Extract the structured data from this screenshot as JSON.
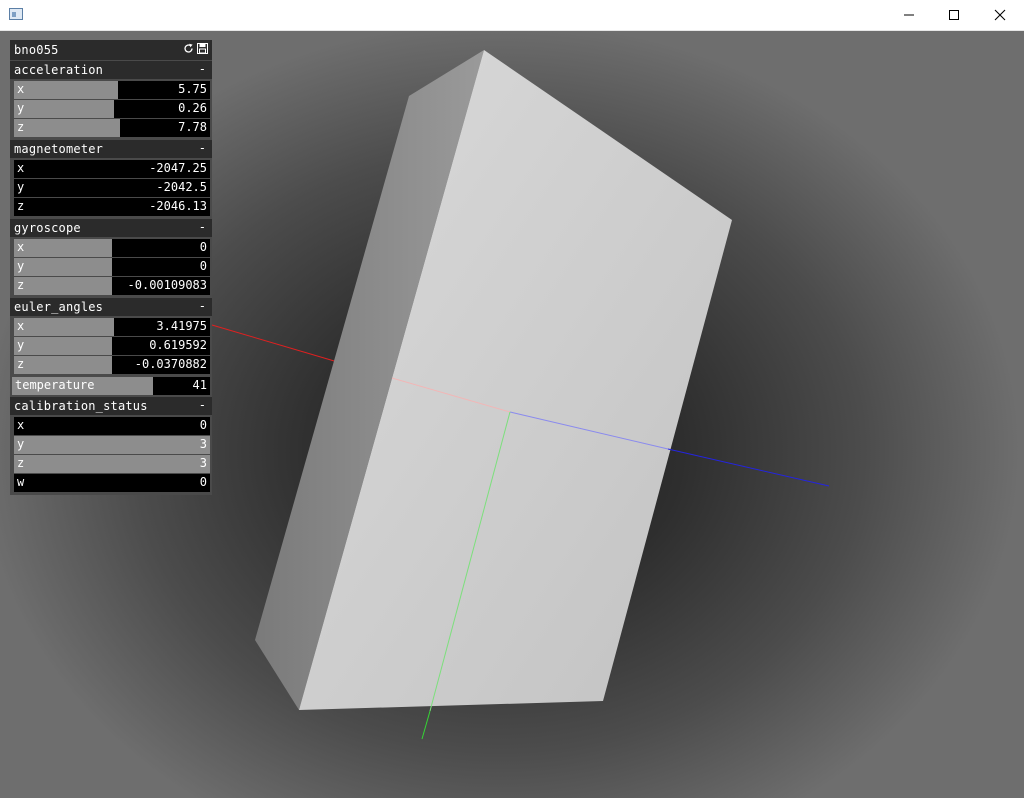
{
  "window": {
    "icon": "app-window-icon",
    "controls": [
      "minimize-icon",
      "maximize-icon",
      "close-icon"
    ]
  },
  "gui": {
    "title": "bno055",
    "header_icons": [
      "refresh-icon",
      "save-icon"
    ],
    "collapse_label": "-",
    "panels": {
      "acceleration": {
        "label": "acceleration",
        "rows": [
          {
            "label": "x",
            "value": "5.75",
            "fill": 0.53
          },
          {
            "label": "y",
            "value": "0.26",
            "fill": 0.51
          },
          {
            "label": "z",
            "value": "7.78",
            "fill": 0.54
          }
        ]
      },
      "magnetometer": {
        "label": "magnetometer",
        "rows": [
          {
            "label": "x",
            "value": "-2047.25",
            "fill": 0.0
          },
          {
            "label": "y",
            "value": "-2042.5",
            "fill": 0.0
          },
          {
            "label": "z",
            "value": "-2046.13",
            "fill": 0.0
          }
        ]
      },
      "gyroscope": {
        "label": "gyroscope",
        "rows": [
          {
            "label": "x",
            "value": "0",
            "fill": 0.5
          },
          {
            "label": "y",
            "value": "0",
            "fill": 0.5
          },
          {
            "label": "z",
            "value": "-0.00109083",
            "fill": 0.5
          }
        ]
      },
      "euler_angles": {
        "label": "euler_angles",
        "rows": [
          {
            "label": "x",
            "value": "3.41975",
            "fill": 0.51
          },
          {
            "label": "y",
            "value": "0.619592",
            "fill": 0.5
          },
          {
            "label": "z",
            "value": "-0.0370882",
            "fill": 0.5
          }
        ]
      },
      "temperature": {
        "label": "temperature",
        "value": "41",
        "fill": 0.71
      },
      "calibration_status": {
        "label": "calibration_status",
        "rows": [
          {
            "label": "x",
            "value": "0",
            "fill": 0.0
          },
          {
            "label": "y",
            "value": "3",
            "fill": 1.0
          },
          {
            "label": "z",
            "value": "3",
            "fill": 1.0
          },
          {
            "label": "w",
            "value": "0",
            "fill": 0.0
          }
        ]
      }
    }
  },
  "scene": {
    "axis_colors": {
      "x": "#e02020",
      "y": "#34d634",
      "z": "#2424e0"
    },
    "box_color": "#d0d0d0"
  }
}
